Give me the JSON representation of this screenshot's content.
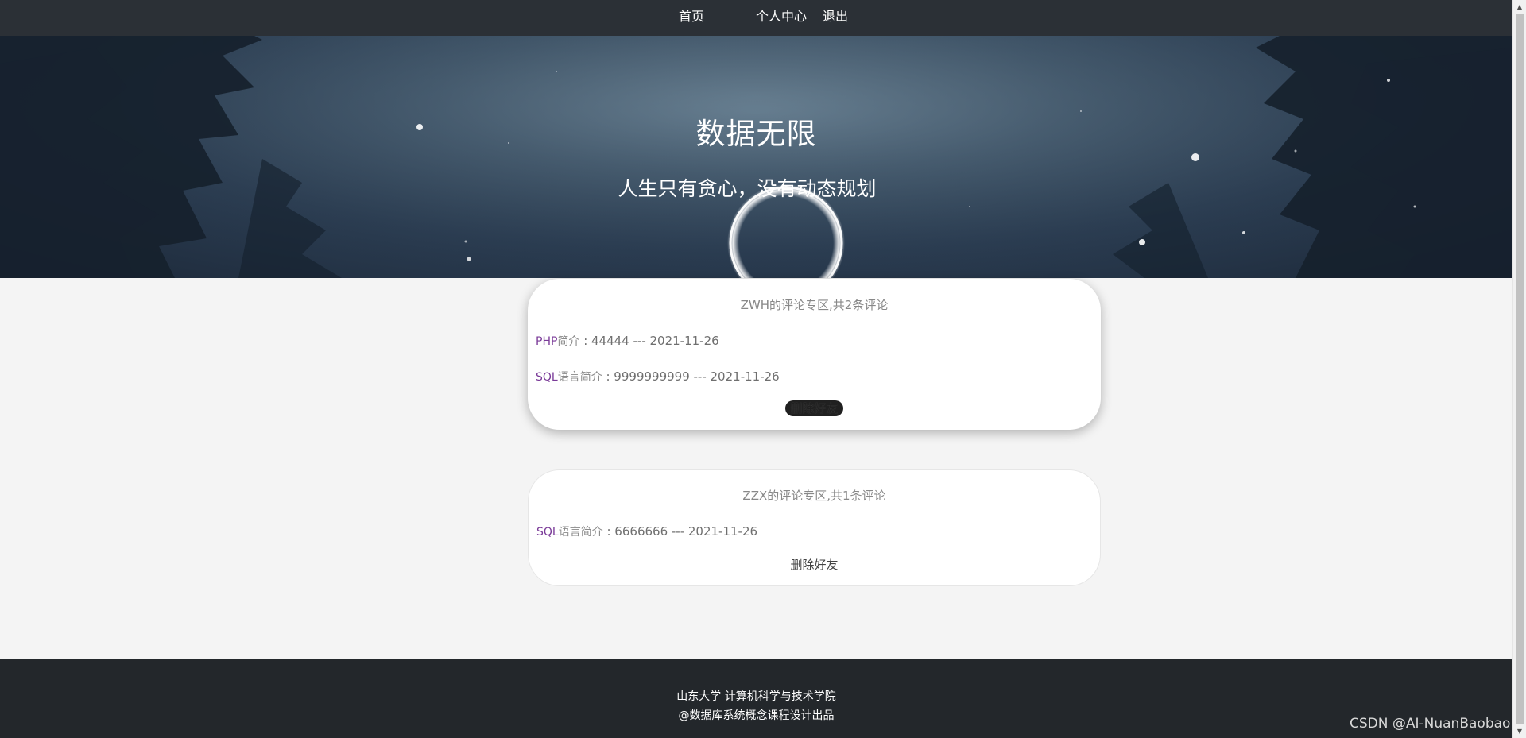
{
  "nav": {
    "home": "首页",
    "profile": "个人中心",
    "logout": "退出"
  },
  "hero": {
    "title": "数据无限",
    "subtitle": "人生只有贪心，没有动态规划"
  },
  "cards": [
    {
      "header": "ZWH的评论专区,共2条评论",
      "comments": [
        {
          "lang": "PHP",
          "kind": "简介",
          "rest": " : 44444 --- 2021-11-26"
        },
        {
          "lang": "SQL",
          "kind": "语言简介",
          "rest": " : 9999999999 --- 2021-11-26"
        }
      ],
      "delete_label": "删除好友"
    },
    {
      "header": "ZZX的评论专区,共1条评论",
      "comments": [
        {
          "lang": "SQL",
          "kind": "语言简介",
          "rest": " : 6666666 --- 2021-11-26"
        }
      ],
      "delete_label": "删除好友"
    }
  ],
  "footer": {
    "line1": "山东大学 计算机科学与技术学院",
    "line2": "@数据库系统概念课程设计出品"
  },
  "watermark": "CSDN @AI-NuanBaobao",
  "colors": {
    "nav_bg": "#2b3036",
    "footer_bg": "#23272b",
    "page_bg": "#f4f4f4",
    "lang_accent": "#7a3a98"
  },
  "icons": {
    "scroll_up": "triangle-up-icon",
    "scroll_down": "triangle-down-icon"
  }
}
